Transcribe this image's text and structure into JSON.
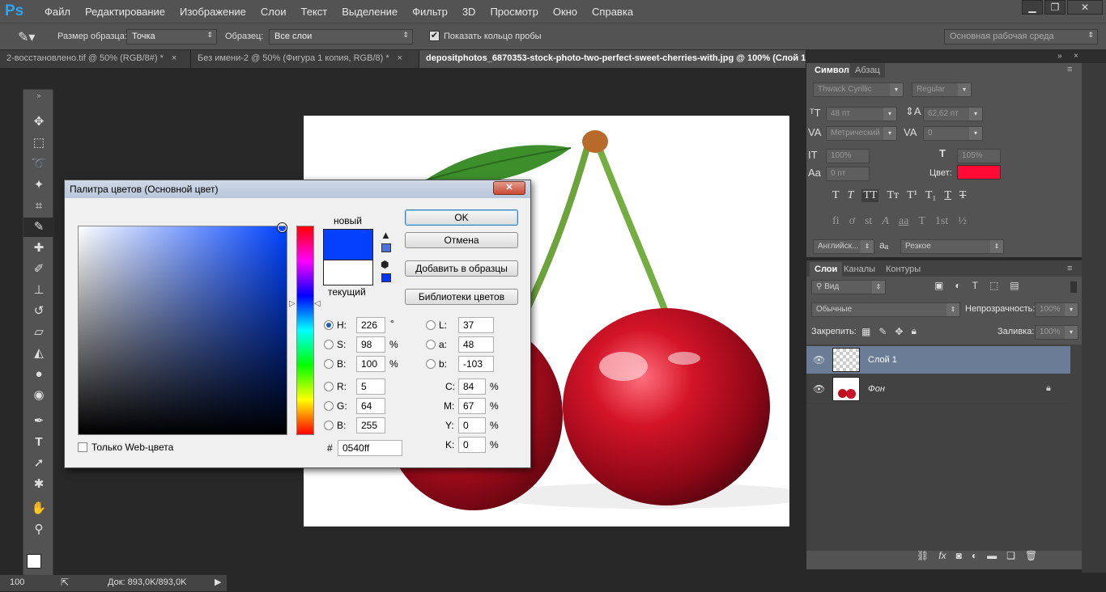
{
  "app": {
    "logo": "Ps"
  },
  "menu": [
    "Файл",
    "Редактирование",
    "Изображение",
    "Слои",
    "Текст",
    "Выделение",
    "Фильтр",
    "3D",
    "Просмотр",
    "Окно",
    "Справка"
  ],
  "window_controls": {
    "min": "▁",
    "restore": "❐",
    "close": "✕"
  },
  "options": {
    "sample_size_label": "Размер образца:",
    "sample_size_value": "Точка",
    "sample_label": "Образец:",
    "sample_value": "Все слои",
    "show_ring_label": "Показать кольцо пробы",
    "workspace": "Основная рабочая среда"
  },
  "tabs": [
    {
      "label": "2-восстановлено.tif @ 50% (RGB/8#) *"
    },
    {
      "label": "Без имени-2 @ 50% (Фигура 1 копия, RGB/8) *"
    },
    {
      "label": "depositphotos_6870353-stock-photo-two-perfect-sweet-cherries-with.jpg @ 100% (Слой 1"
    }
  ],
  "status": {
    "zoom": "100",
    "doc": "Док: 893,0K/893,0K"
  },
  "dialog": {
    "title": "Палитра цветов (Основной цвет)",
    "close": "✕",
    "new_label": "новый",
    "current_label": "текущий",
    "new_color": "#0540ff",
    "current_color": "#ffffff",
    "ok": "OK",
    "cancel": "Отмена",
    "add_swatch": "Добавить в образцы",
    "libraries": "Библиотеки цветов",
    "web_only": "Только Web-цвета",
    "fields": {
      "H": "226",
      "S": "98",
      "B": "100",
      "R": "5",
      "G": "64",
      "B2": "255",
      "L": "37",
      "a": "48",
      "b": "-103",
      "C": "84",
      "M": "67",
      "Y": "0",
      "K": "0"
    },
    "hex_label": "#",
    "hex": "0540ff"
  },
  "character": {
    "tab_char": "Символ",
    "tab_para": "Абзац",
    "font_family": "Thwack Cyrillic",
    "font_style": "Regular",
    "size": "48 пт",
    "leading": "62,62 пт",
    "kerning": "Метрический",
    "tracking": "0",
    "vscale": "100%",
    "hscale": "105%",
    "baseline": "0 пт",
    "color_label": "Цвет:",
    "text_color": "#ff0a35",
    "language": "Английск...",
    "aa_label": "aₐ",
    "antialias": "Резкое"
  },
  "layers": {
    "tab_layers": "Слои",
    "tab_channels": "Каналы",
    "tab_paths": "Контуры",
    "filter": "Вид",
    "blend": "Обычные",
    "opacity_label": "Непрозрачность:",
    "opacity": "100%",
    "lock_label": "Закрепить:",
    "fill_label": "Заливка:",
    "fill": "100%",
    "items": [
      {
        "name": "Слой 1"
      },
      {
        "name": "Фон"
      }
    ]
  }
}
